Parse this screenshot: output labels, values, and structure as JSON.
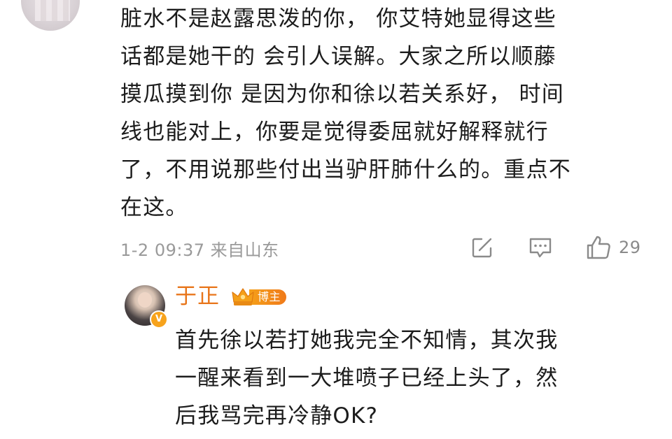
{
  "comment": {
    "lines": [
      "脏水不是赵露思泼的你， 你艾特她显得这些",
      "话都是她干的 会引人误解。大家之所以顺藤",
      "摸瓜摸到你 是因为你和徐以若关系好， 时间",
      "线也能对上，你要是觉得委屈就好解释就行",
      "了，不用说那些付出当驴肝肺什么的。重点不",
      "在这。"
    ],
    "timestamp": "1-2 09:37 来自山东",
    "actions": {
      "share_icon": "share-edit-icon",
      "comment_icon": "comment-bubble-icon",
      "like_icon": "thumbs-up-icon",
      "like_count": "29"
    }
  },
  "reply": {
    "author": "于正",
    "badge_label": "博主",
    "badge_icon": "crown-icon",
    "vip_mark": "V",
    "lines": [
      "首先徐以若打她我完全不知情，其次我",
      "一醒来看到一大堆喷子已经上头了，然",
      "后我骂完再冷静OK?"
    ]
  },
  "colors": {
    "text": "#1c1c1c",
    "meta": "#9a9a9a",
    "author_name": "#e8751a",
    "badge": "#f5a019"
  }
}
